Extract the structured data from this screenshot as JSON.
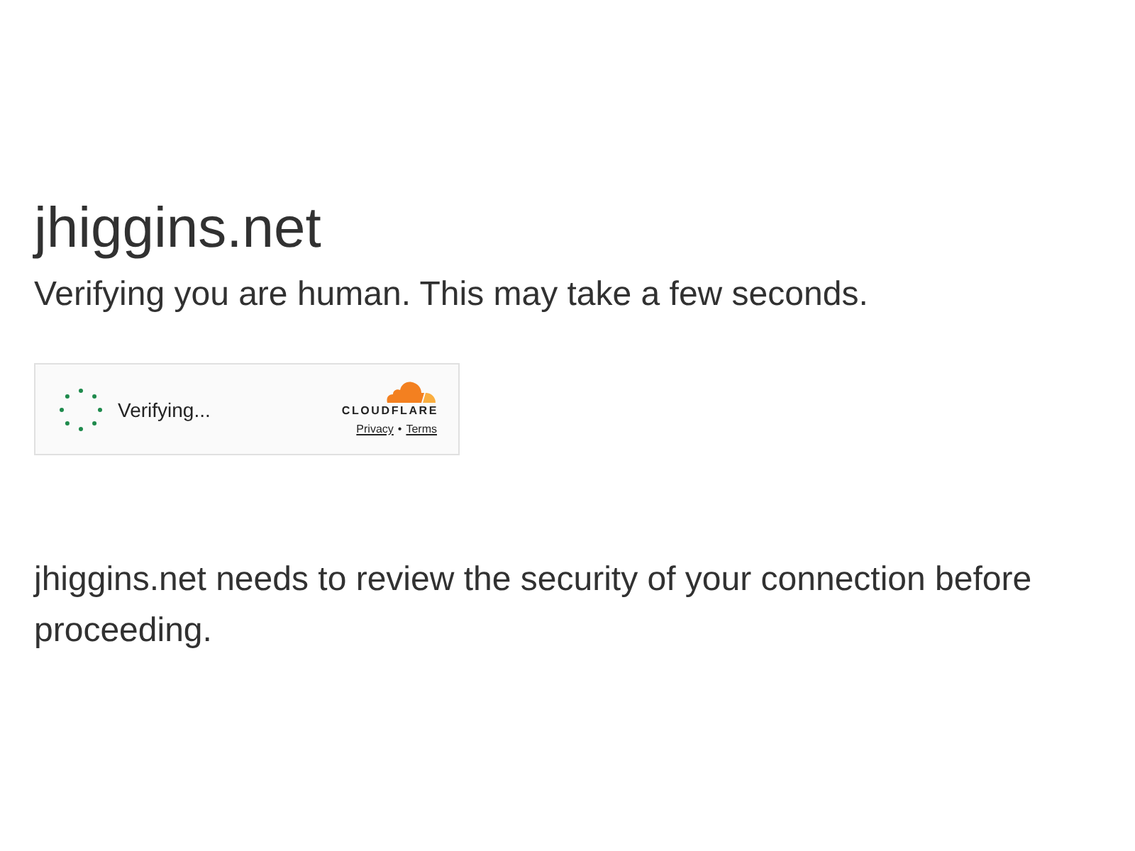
{
  "header": {
    "title": "jhiggins.net",
    "subtitle": "Verifying you are human. This may take a few seconds."
  },
  "widget": {
    "status": "Verifying...",
    "logo_text": "CLOUDFLARE",
    "links": [
      {
        "label": "Privacy"
      },
      {
        "label": "Terms"
      }
    ],
    "separator": "•"
  },
  "message": "jhiggins.net needs to review the security of your connection before proceeding."
}
